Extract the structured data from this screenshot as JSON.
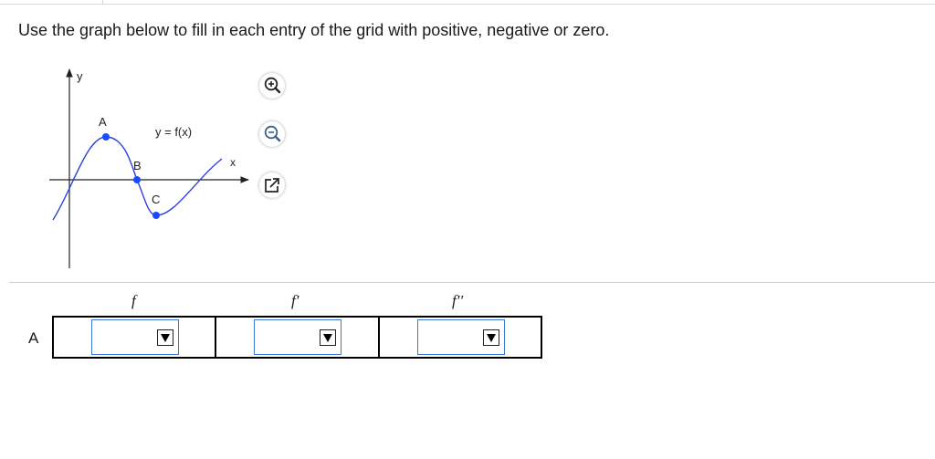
{
  "instruction": "Use the graph below to fill in each entry of the grid with positive, negative or zero.",
  "graph": {
    "y_axis_label": "y",
    "x_axis_label": "x",
    "curve_label": "y = f(x)",
    "points": {
      "A": "A",
      "B": "B",
      "C": "C"
    },
    "curve_color": "#2a3fe0",
    "point_color": "#1a4bff"
  },
  "tools": [
    "zoom-in-icon",
    "zoom-out-icon",
    "popout-icon"
  ],
  "table": {
    "columns": [
      "f",
      "f′",
      "f′′"
    ],
    "rows": [
      {
        "label": "A",
        "values": [
          "",
          "",
          ""
        ]
      }
    ],
    "dropdown_arrow": "▼"
  }
}
